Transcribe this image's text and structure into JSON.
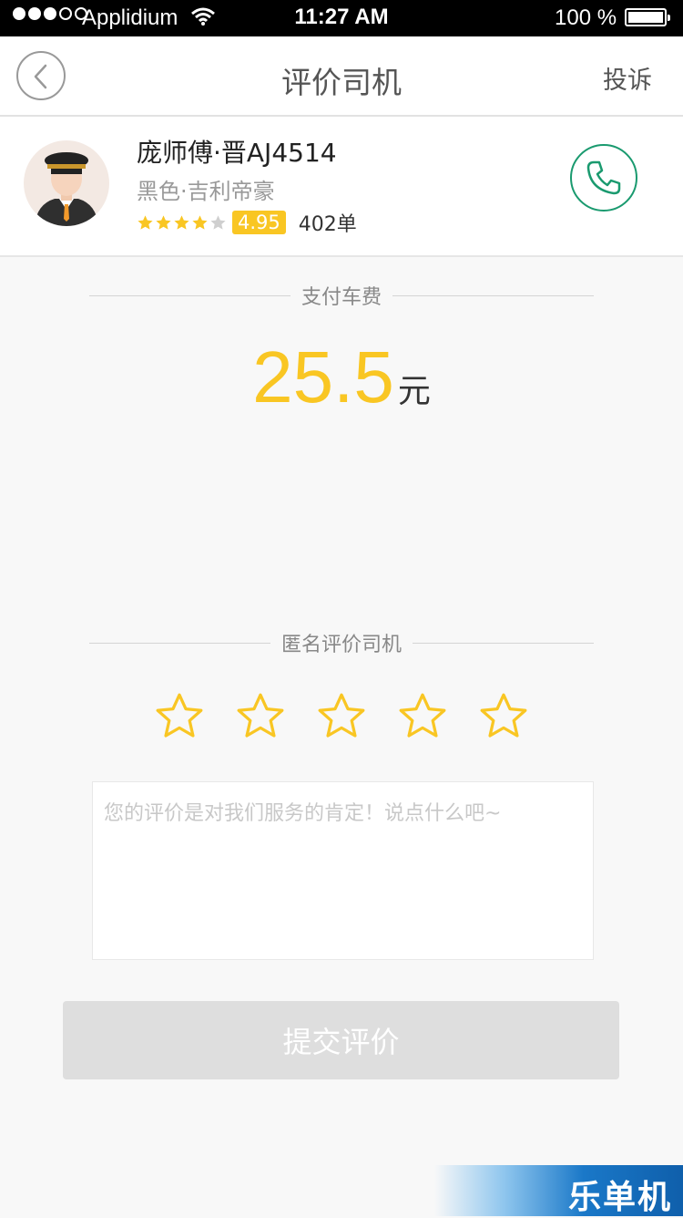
{
  "status_bar": {
    "carrier": "Applidium",
    "time": "11:27 AM",
    "battery": "100 %"
  },
  "nav": {
    "title": "评价司机",
    "complain": "投诉"
  },
  "driver": {
    "name": "庞师傅·晋AJ4514",
    "car": "黑色·吉利帝豪",
    "stars_filled": 4,
    "stars_total": 5,
    "score": "4.95",
    "orders": "402单"
  },
  "payment": {
    "section_label": "支付车费",
    "amount": "25.5",
    "unit": "元"
  },
  "rating": {
    "section_label": "匿名评价司机",
    "stars_total": 5,
    "comment_placeholder": "您的评价是对我们服务的肯定！说点什么吧~"
  },
  "submit": {
    "label": "提交评价"
  },
  "watermark": {
    "text": "乐单机"
  },
  "colors": {
    "accent": "#f9c623",
    "phone": "#1a9a6f",
    "button_disabled": "#dedede"
  }
}
